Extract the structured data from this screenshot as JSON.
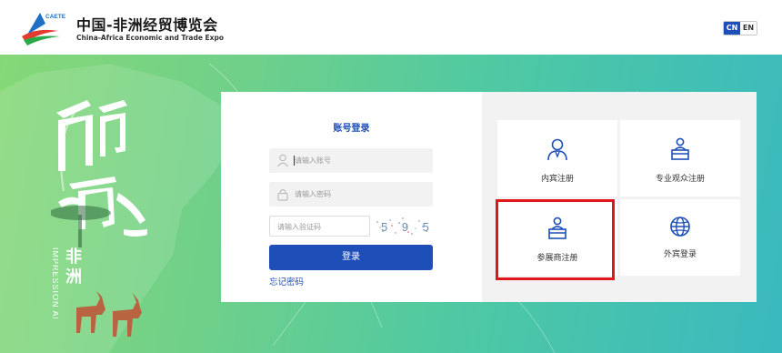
{
  "header": {
    "logo_text": "CAETE",
    "title_cn": "中国-非洲经贸博览会",
    "title_en": "China-Africa Economic and Trade Expo",
    "lang_cn": "CN",
    "lang_en": "EN"
  },
  "hero": {
    "calligraphy": "印象",
    "subtitle_en": "IMPRESSION AFRICA",
    "subtitle_cn": "非洲"
  },
  "login": {
    "title": "账号登录",
    "account_placeholder": "请输入账号",
    "password_placeholder": "请输入密码",
    "captcha_placeholder": "请输入验证码",
    "captcha_text": "5 9 5",
    "button": "登录",
    "forgot": "忘记密码"
  },
  "tiles": [
    {
      "label": "内宾注册",
      "icon": "person-icon"
    },
    {
      "label": "专业观众注册",
      "icon": "podium-person-icon"
    },
    {
      "label": "参展商注册",
      "icon": "podium-person-icon"
    },
    {
      "label": "外宾登录",
      "icon": "globe-icon"
    }
  ],
  "colors": {
    "primary": "#1e4fb8",
    "highlight": "#e0161c",
    "hero_start": "#86d877",
    "hero_end": "#3ab9bf"
  }
}
